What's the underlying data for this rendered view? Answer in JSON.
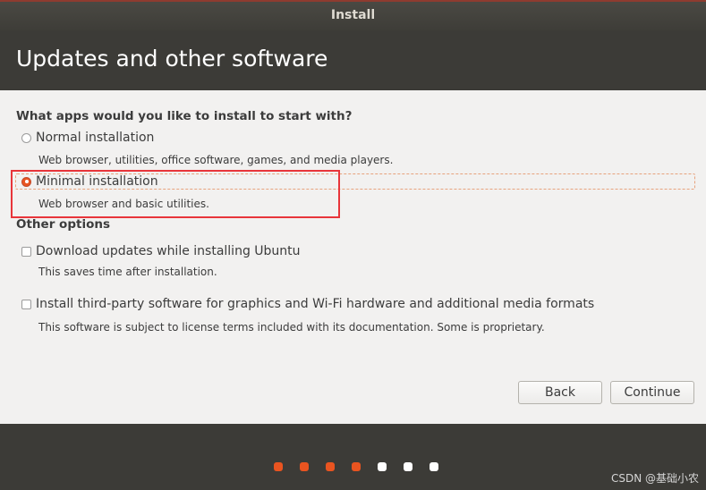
{
  "window": {
    "title": "Install"
  },
  "page": {
    "heading": "Updates and other software"
  },
  "install_type": {
    "question": "What apps would you like to install to start with?",
    "options": [
      {
        "label": "Normal installation",
        "description": "Web browser, utilities, office software, games, and media players.",
        "selected": false
      },
      {
        "label": "Minimal installation",
        "description": "Web browser and basic utilities.",
        "selected": true
      }
    ]
  },
  "other_options": {
    "heading": "Other options",
    "items": [
      {
        "label": "Download updates while installing Ubuntu",
        "description": "This saves time after installation.",
        "checked": false
      },
      {
        "label": "Install third-party software for graphics and Wi-Fi hardware and additional media formats",
        "description": "This software is subject to license terms included with its documentation. Some is proprietary.",
        "checked": false
      }
    ]
  },
  "buttons": {
    "back": "Back",
    "continue": "Continue"
  },
  "progress": {
    "total_steps": 7,
    "completed_steps": 4
  },
  "watermark": "CSDN @基础小农",
  "colors": {
    "accent": "#e95420",
    "progress_done": "#e95420",
    "progress_todo": "#ffffff",
    "header_bg": "#3c3b37",
    "highlight_box": "#e8353a"
  }
}
